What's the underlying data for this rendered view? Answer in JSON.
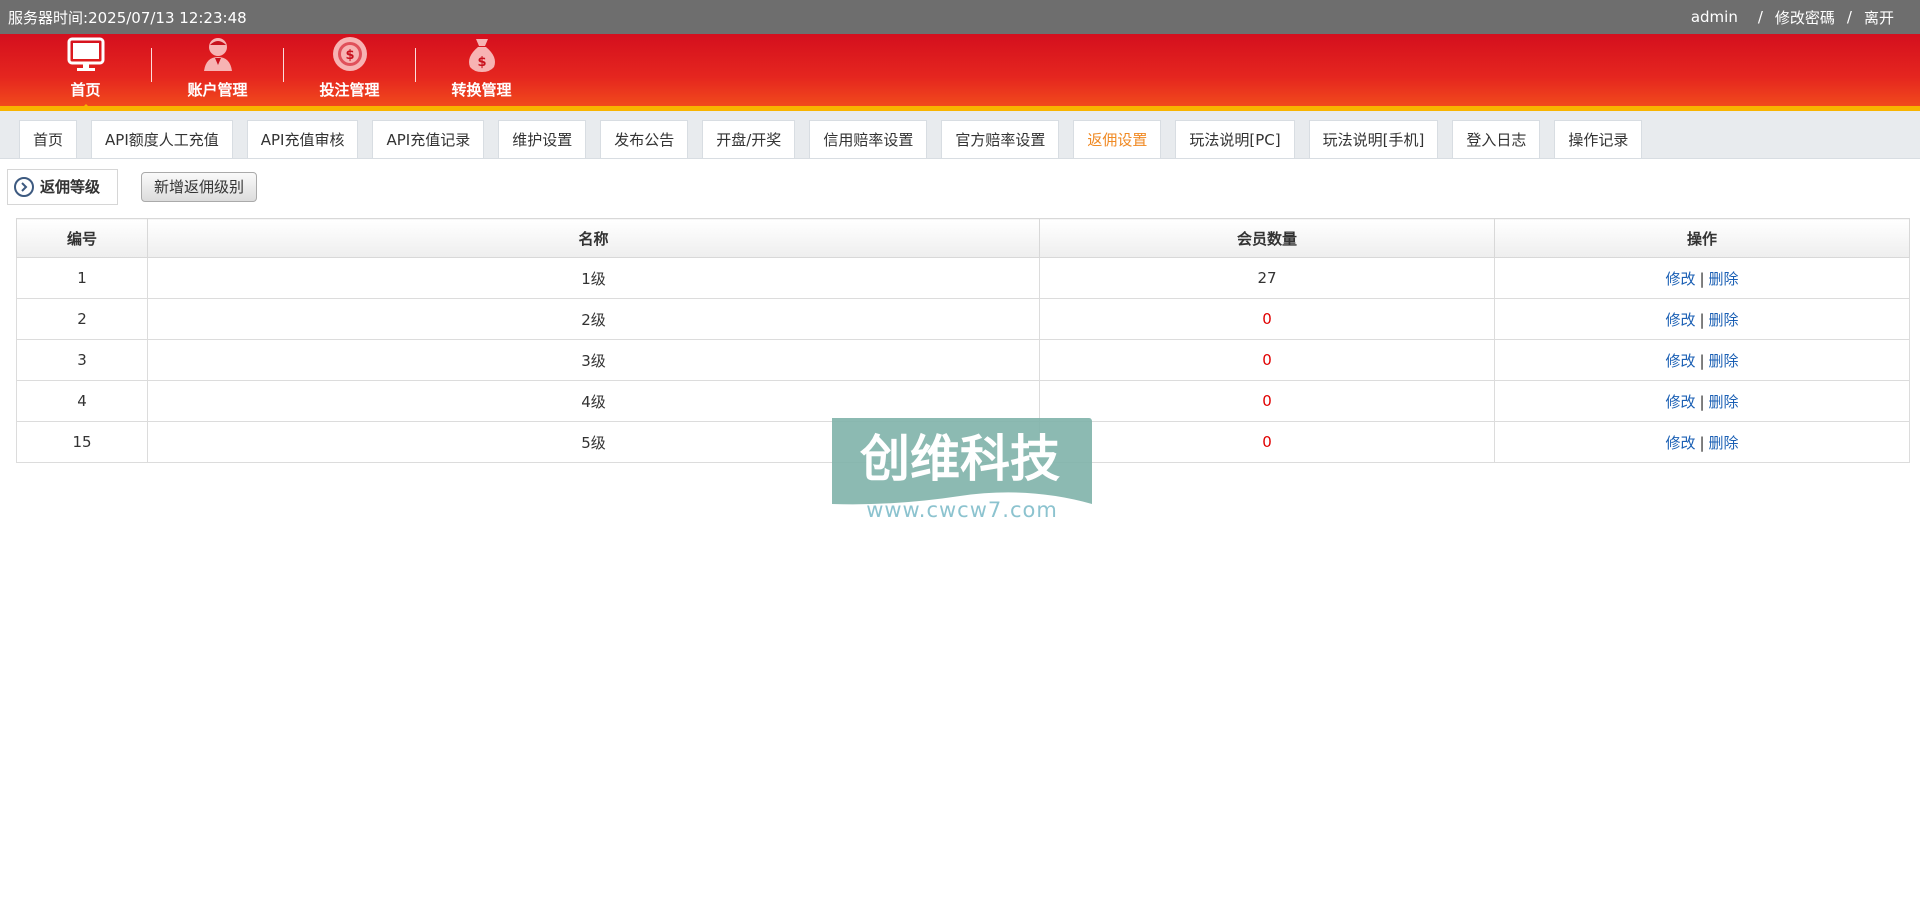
{
  "topbar": {
    "server_time_label": "服务器时间:",
    "server_time": "2025/07/13 12:23:48",
    "user": "admin",
    "sep1": "/",
    "change_password": "修改密碼",
    "sep2": "/",
    "logout": "离开"
  },
  "mainnav": {
    "items": [
      {
        "label": "首页",
        "icon": "monitor-icon"
      },
      {
        "label": "账户管理",
        "icon": "user-icon"
      },
      {
        "label": "投注管理",
        "icon": "coin-icon"
      },
      {
        "label": "转换管理",
        "icon": "money-bag-icon"
      }
    ],
    "accent": "#f8b400"
  },
  "tabs": [
    {
      "label": "首页"
    },
    {
      "label": "API额度人工充值"
    },
    {
      "label": "API充值审核"
    },
    {
      "label": "API充值记录"
    },
    {
      "label": "维护设置"
    },
    {
      "label": "发布公告"
    },
    {
      "label": "开盘/开奖"
    },
    {
      "label": "信用赔率设置"
    },
    {
      "label": "官方赔率设置"
    },
    {
      "label": "返佣设置",
      "active": true
    },
    {
      "label": "玩法说明[PC]"
    },
    {
      "label": "玩法说明[手机]"
    },
    {
      "label": "登入日志"
    },
    {
      "label": "操作记录"
    }
  ],
  "toolbar": {
    "section_label": "返佣等级",
    "add_button": "新增返佣级别"
  },
  "table": {
    "headers": [
      "编号",
      "名称",
      "会员数量",
      "操作"
    ],
    "rows": [
      {
        "id": "1",
        "name": "1级",
        "members": "27",
        "edit": "修改",
        "delete": "删除"
      },
      {
        "id": "2",
        "name": "2级",
        "members": "0",
        "edit": "修改",
        "delete": "删除"
      },
      {
        "id": "3",
        "name": "3级",
        "members": "0",
        "edit": "修改",
        "delete": "删除"
      },
      {
        "id": "4",
        "name": "4级",
        "members": "0",
        "edit": "修改",
        "delete": "删除"
      },
      {
        "id": "15",
        "name": "5级",
        "members": "0",
        "edit": "修改",
        "delete": "删除"
      }
    ],
    "pipe": "|"
  },
  "watermark": {
    "title": "创维科技",
    "url": "www.cwcw7.com"
  },
  "colors": {
    "active_tab": "#f08a24",
    "zero_value": "#e00000",
    "link": "#1a5fb4"
  }
}
